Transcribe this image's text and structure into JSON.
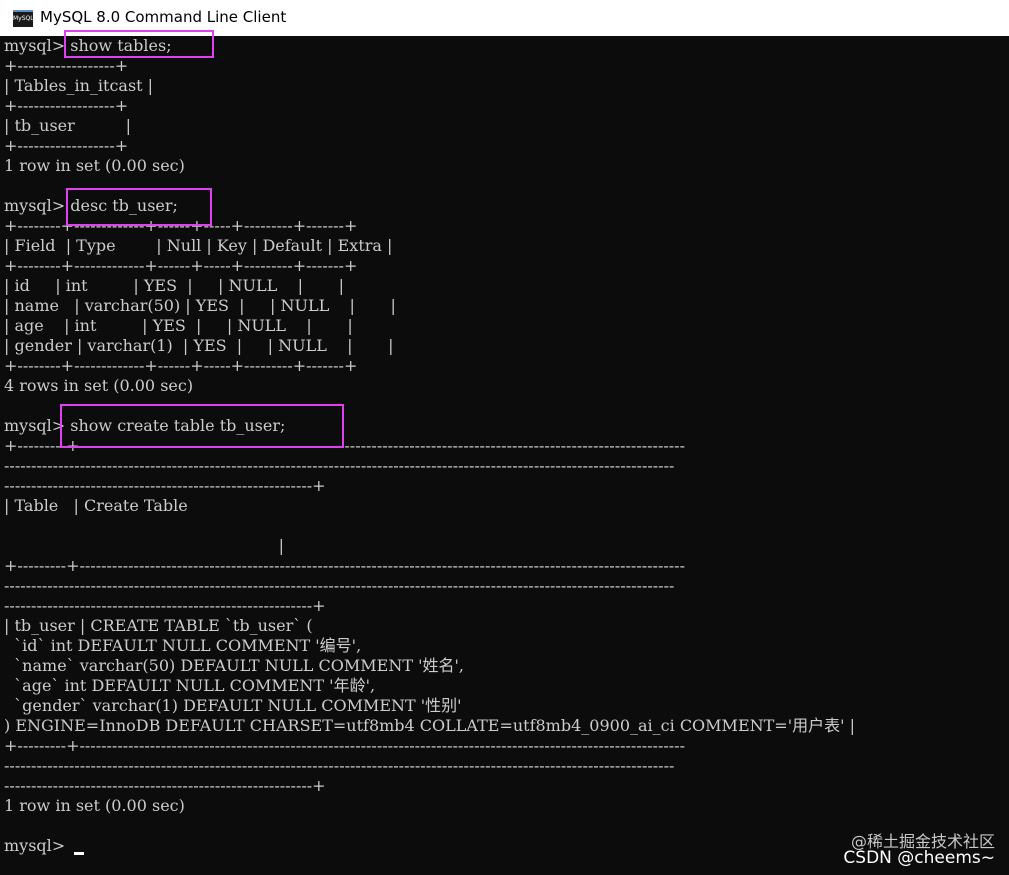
{
  "window": {
    "title": "MySQL 8.0 Command Line Client",
    "icon_label": "MySQL"
  },
  "console": {
    "lines": [
      "mysql> show tables;",
      "+------------------+",
      "| Tables_in_itcast |",
      "+------------------+",
      "| tb_user          |",
      "+------------------+",
      "1 row in set (0.00 sec)",
      "",
      "mysql> desc tb_user;",
      "+--------+-------------+------+-----+---------+-------+",
      "| Field  | Type        | Null | Key | Default | Extra |",
      "+--------+-------------+------+-----+---------+-------+",
      "| id     | int         | YES  |     | NULL    |       |",
      "| name   | varchar(50) | YES  |     | NULL    |       |",
      "| age    | int         | YES  |     | NULL    |       |",
      "| gender | varchar(1)  | YES  |     | NULL    |       |",
      "+--------+-------------+------+-----+---------+-------+",
      "4 rows in set (0.00 sec)",
      "",
      "mysql> show create table tb_user;",
      "+---------+----------------------------------------------------------------------------------------------------------------",
      "----------------------------------------------------------------------------------------------------------------------------",
      "---------------------------------------------------------+",
      "| Table   | Create Table",
      "",
      "                                                      |",
      "+---------+----------------------------------------------------------------------------------------------------------------",
      "----------------------------------------------------------------------------------------------------------------------------",
      "---------------------------------------------------------+",
      "| tb_user | CREATE TABLE `tb_user` (",
      "  `id` int DEFAULT NULL COMMENT '编号',",
      "  `name` varchar(50) DEFAULT NULL COMMENT '姓名',",
      "  `age` int DEFAULT NULL COMMENT '年龄',",
      "  `gender` varchar(1) DEFAULT NULL COMMENT '性别'",
      ") ENGINE=InnoDB DEFAULT CHARSET=utf8mb4 COLLATE=utf8mb4_0900_ai_ci COMMENT='用户表' |",
      "+---------+----------------------------------------------------------------------------------------------------------------",
      "----------------------------------------------------------------------------------------------------------------------------",
      "---------------------------------------------------------+",
      "1 row in set (0.00 sec)",
      "",
      "mysql> "
    ]
  },
  "watermark": {
    "line1": "@稀土掘金技术社区",
    "line2": "CSDN @cheems~"
  }
}
